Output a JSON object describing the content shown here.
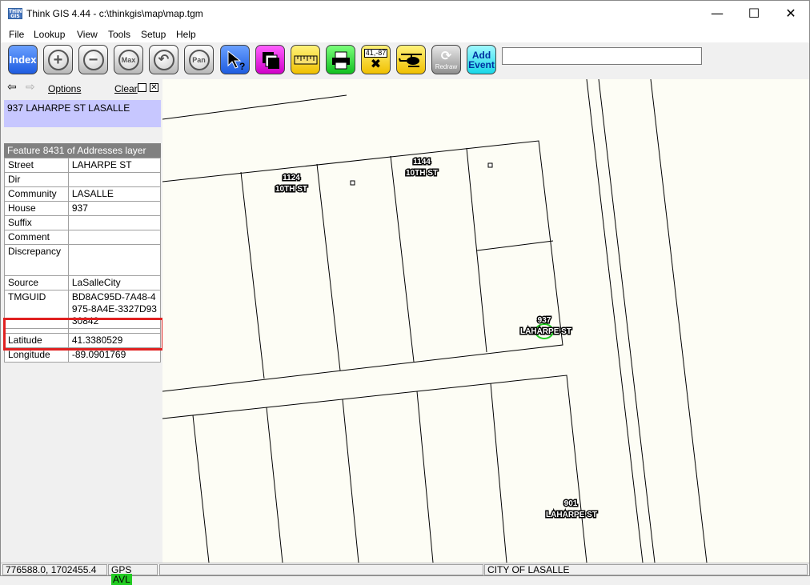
{
  "window": {
    "title": "Think GIS 4.44 - c:\\thinkgis\\map\\map.tgm",
    "app_icon_text": "THINK GIS",
    "minimize": "—",
    "maximize": "☐",
    "close": "✕"
  },
  "menu": [
    "File",
    "Lookup",
    "View",
    "Tools",
    "Setup",
    "Help"
  ],
  "toolbar": {
    "index": "Index",
    "zoom_in": "+",
    "zoom_out": "−",
    "zoom_max": "Max",
    "zoom_prev": "↶",
    "pan": "Pan",
    "identify": "?",
    "coord_label": "41,-87",
    "redraw": "Redraw",
    "add_event_line1": "Add",
    "add_event_line2": "Event",
    "command_value": ""
  },
  "panel": {
    "back": "⇦",
    "forward": "⇨",
    "options": "Options",
    "clear": "Clear",
    "address": "937 LAHARPE ST LASALLE",
    "feature_header": "Feature 8431 of Addresses layer",
    "attributes": [
      {
        "key": "Street",
        "value": "LAHARPE ST"
      },
      {
        "key": "Dir",
        "value": ""
      },
      {
        "key": "Community",
        "value": "LASALLE"
      },
      {
        "key": "House",
        "value": "937"
      },
      {
        "key": "Suffix",
        "value": ""
      },
      {
        "key": "Comment",
        "value": ""
      },
      {
        "key": "Discrepancy",
        "value": ""
      },
      {
        "key": "Source",
        "value": "LaSalleCity"
      },
      {
        "key": "TMGUID",
        "value": "BD8AC95D-7A48-4975-8A4E-3327D9330842"
      }
    ],
    "coords": [
      {
        "key": "Latitude",
        "value": "41.3380529"
      },
      {
        "key": "Longitude",
        "value": "-89.0901769"
      }
    ]
  },
  "map": {
    "labels": [
      {
        "num": "1124",
        "street": "10TH ST"
      },
      {
        "num": "1144",
        "street": "10TH ST"
      },
      {
        "num": "937",
        "street": "LAHARPE ST"
      },
      {
        "num": "901",
        "street": "LAHARPE ST"
      }
    ]
  },
  "status": {
    "coords": "776588.0, 1702455.4",
    "gps": "GPS",
    "avl": "AVL",
    "middle": "",
    "city": "CITY OF LASALLE"
  }
}
